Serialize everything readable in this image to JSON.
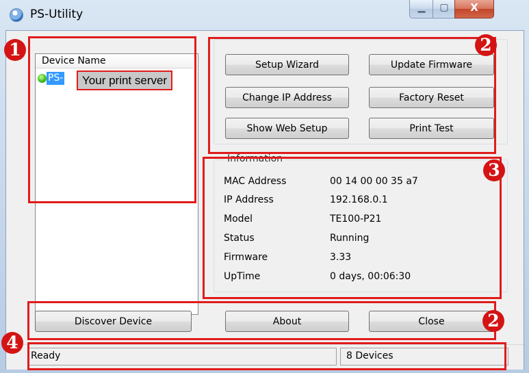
{
  "window": {
    "title": "PS-Utility",
    "icon": "app-globe-icon"
  },
  "device_list": {
    "column_header": "Device Name",
    "selected_device_prefix": "PS-",
    "callout": "Your print server"
  },
  "buttons": {
    "setup_wizard": "Setup Wizard",
    "update_firmware": "Update Firmware",
    "change_ip": "Change IP Address",
    "factory_reset": "Factory Reset",
    "show_web_setup": "Show Web Setup",
    "print_test": "Print Test",
    "discover_device": "Discover Device",
    "about": "About",
    "close": "Close"
  },
  "information": {
    "legend": "Information",
    "rows": [
      {
        "label": "MAC Address",
        "value": "00 14 00 00 35 a7"
      },
      {
        "label": "IP Address",
        "value": "192.168.0.1"
      },
      {
        "label": "Model",
        "value": "TE100-P21"
      },
      {
        "label": "Status",
        "value": "Running"
      },
      {
        "label": "Firmware",
        "value": "3.33"
      },
      {
        "label": "UpTime",
        "value": "0 days, 00:06:30"
      }
    ]
  },
  "statusbar": {
    "left": "Ready",
    "right": "8 Devices"
  },
  "annotations": {
    "badge_1": "1",
    "badge_2": "2",
    "badge_3": "3",
    "badge_2b": "2",
    "badge_4": "4",
    "color": "#e01b1b"
  }
}
